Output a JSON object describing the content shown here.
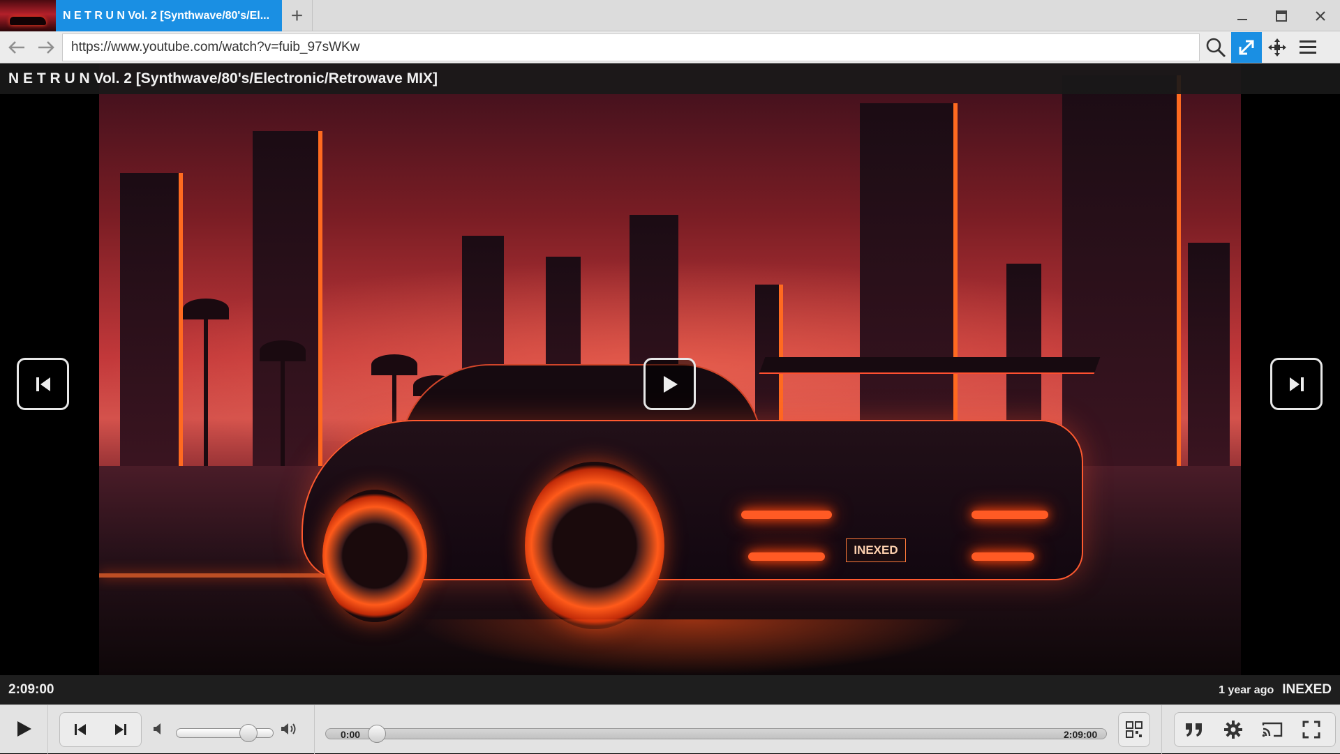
{
  "tab": {
    "title": "N E T R U N Vol. 2 [Synthwave/80's/El...",
    "new_tab_symbol": "+"
  },
  "window": {
    "minimize_icon": "minimize-icon",
    "maximize_icon": "maximize-icon",
    "close_icon": "close-icon"
  },
  "address": {
    "url": "https://www.youtube.com/watch?v=fuib_97sWKw"
  },
  "toolbar": {
    "icons": [
      "search-icon",
      "expand-icon",
      "move-icon",
      "menu-icon"
    ],
    "active_color": "#1a8fe3"
  },
  "video": {
    "title": "N E T R U N Vol. 2 [Synthwave/80's/Electronic/Retrowave MIX]",
    "duration": "2:09:00",
    "age": "1 year ago",
    "channel": "INEXED",
    "plate_text": "INEXED"
  },
  "controls": {
    "current_time": "0:00",
    "total_time": "2:09:00",
    "volume_level": 0.8,
    "progress": 0.0
  }
}
